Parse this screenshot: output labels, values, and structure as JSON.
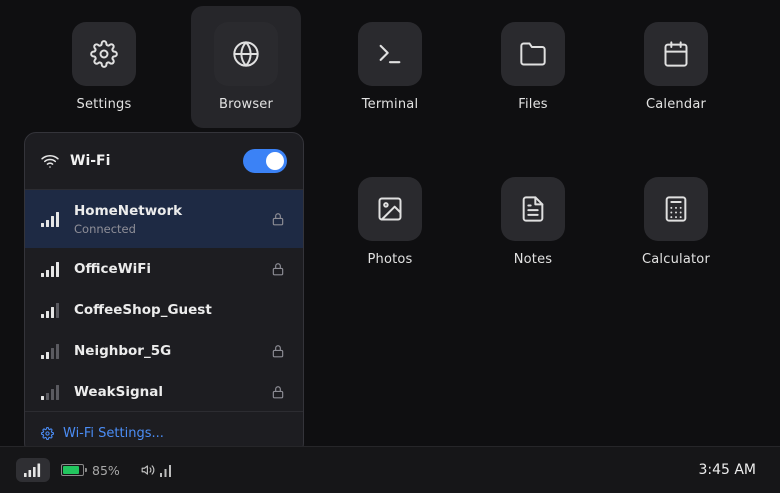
{
  "apps": [
    {
      "name": "Settings",
      "icon": "gear-icon"
    },
    {
      "name": "Browser",
      "icon": "globe-icon"
    },
    {
      "name": "Terminal",
      "icon": "terminal-icon"
    },
    {
      "name": "Files",
      "icon": "folder-icon"
    },
    {
      "name": "Calendar",
      "icon": "calendar-icon"
    },
    {
      "name": "Photos",
      "icon": "image-icon"
    },
    {
      "name": "Notes",
      "icon": "document-icon"
    },
    {
      "name": "Calculator",
      "icon": "calculator-icon"
    }
  ],
  "wifi_panel": {
    "title": "Wi-Fi",
    "enabled": true,
    "networks": [
      {
        "name": "HomeNetwork",
        "status": "Connected",
        "signal_bars": 4,
        "secured": true
      },
      {
        "name": "OfficeWiFi",
        "signal_bars": 4,
        "secured": true
      },
      {
        "name": "CoffeeShop_Guest",
        "signal_bars": 3,
        "secured": false
      },
      {
        "name": "Neighbor_5G",
        "signal_bars": 2,
        "secured": true
      },
      {
        "name": "WeakSignal",
        "signal_bars": 1,
        "secured": true
      }
    ],
    "settings_link": "Wi-Fi Settings..."
  },
  "taskbar": {
    "battery_percent": "85%",
    "battery_level": 0.85,
    "clock": "3:45 AM"
  },
  "colors": {
    "accent": "#3b82f6",
    "battery": "#22c55e",
    "selected_row": "#1e2a44"
  }
}
